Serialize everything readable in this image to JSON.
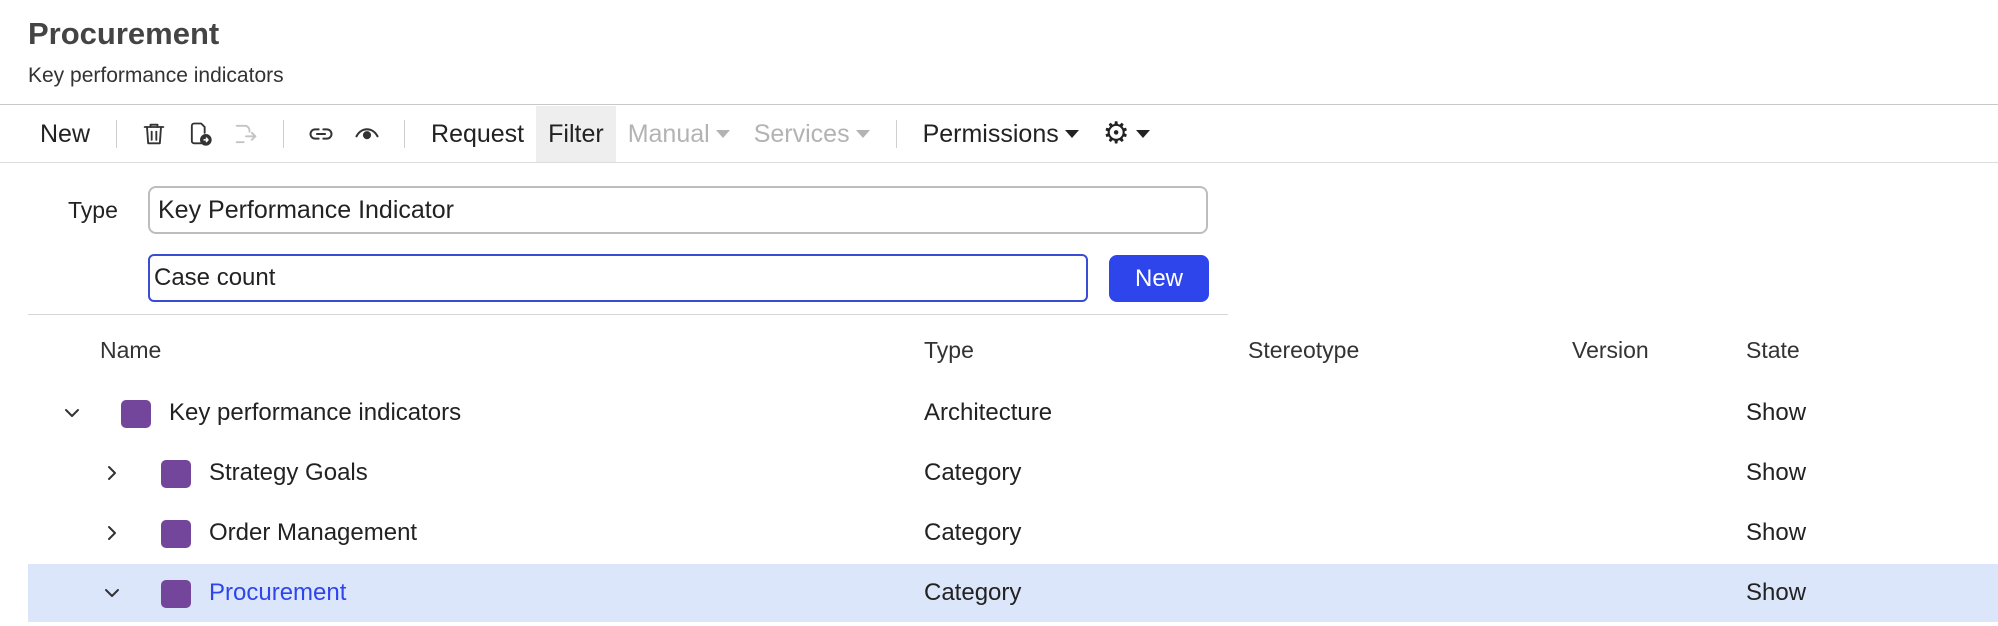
{
  "page": {
    "title": "Procurement",
    "subtitle": "Key performance indicators"
  },
  "toolbar": {
    "new": "New",
    "request": "Request",
    "filter": "Filter",
    "manual": "Manual",
    "services": "Services",
    "permissions": "Permissions",
    "icons": [
      "trash-icon",
      "copy-to-icon",
      "move-icon",
      "link-icon",
      "eye-icon",
      "gear-icon"
    ]
  },
  "form": {
    "type_label": "Type",
    "type_value": "Key Performance Indicator",
    "name_value": "Case count",
    "new_button": "New"
  },
  "table": {
    "headers": {
      "name": "Name",
      "type": "Type",
      "stereotype": "Stereotype",
      "version": "Version",
      "state": "State"
    },
    "rows": [
      {
        "name": "Key performance indicators",
        "type": "Architecture",
        "stereotype": "",
        "version": "",
        "state": "Show",
        "expanded": true
      },
      {
        "name": "Strategy Goals",
        "type": "Category",
        "stereotype": "",
        "version": "",
        "state": "Show",
        "expanded": false
      },
      {
        "name": "Order Management",
        "type": "Category",
        "stereotype": "",
        "version": "",
        "state": "Show",
        "expanded": false
      },
      {
        "name": "Procurement",
        "type": "Category",
        "stereotype": "",
        "version": "",
        "state": "Show",
        "expanded": true
      }
    ]
  },
  "colors": {
    "accent": "#2f45ec",
    "item_square": "#73459b",
    "selected_row": "#dce6fb"
  }
}
